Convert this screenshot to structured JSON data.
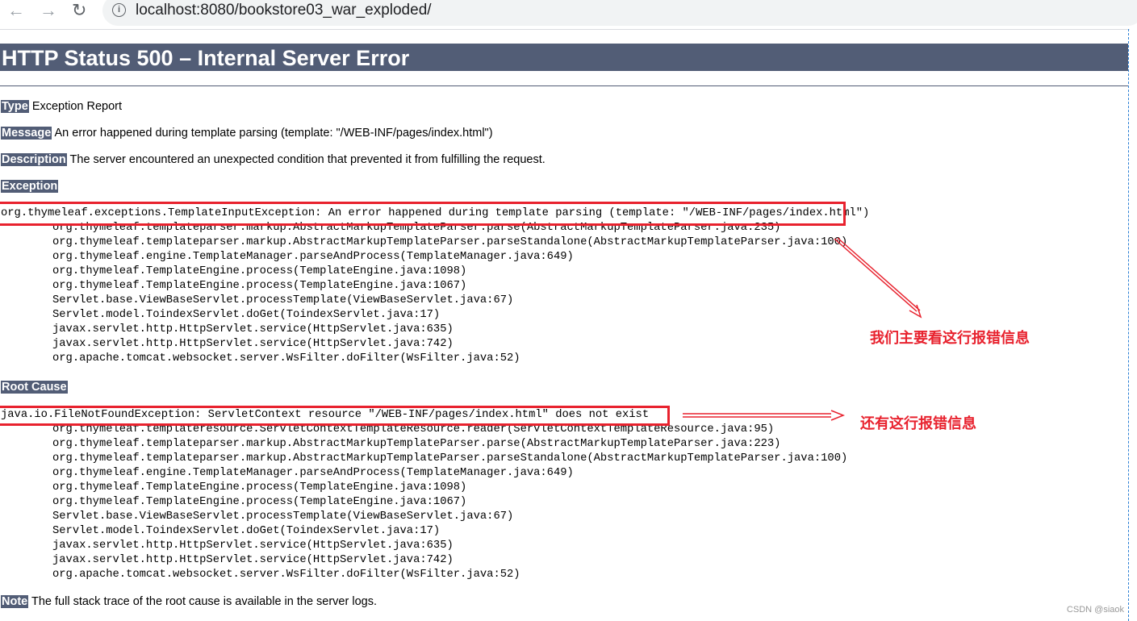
{
  "browser": {
    "url": "localhost:8080/bookstore03_war_exploded/"
  },
  "page": {
    "title": "HTTP Status 500 – Internal Server Error",
    "type": {
      "label": "Type",
      "value": "Exception Report"
    },
    "message": {
      "label": "Message",
      "value": "An error happened during template parsing (template: \"/WEB-INF/pages/index.html\")"
    },
    "description": {
      "label": "Description",
      "value": "The server encountered an unexpected condition that prevented it from fulfilling the request."
    },
    "exception": {
      "label": "Exception",
      "head": "org.thymeleaf.exceptions.TemplateInputException: An error happened during template parsing (template: \"/WEB-INF/pages/index.html\")",
      "lines": [
        "org.thymeleaf.templateparser.markup.AbstractMarkupTemplateParser.parse(AbstractMarkupTemplateParser.java:235)",
        "org.thymeleaf.templateparser.markup.AbstractMarkupTemplateParser.parseStandalone(AbstractMarkupTemplateParser.java:100)",
        "org.thymeleaf.engine.TemplateManager.parseAndProcess(TemplateManager.java:649)",
        "org.thymeleaf.TemplateEngine.process(TemplateEngine.java:1098)",
        "org.thymeleaf.TemplateEngine.process(TemplateEngine.java:1067)",
        "Servlet.base.ViewBaseServlet.processTemplate(ViewBaseServlet.java:67)",
        "Servlet.model.ToindexServlet.doGet(ToindexServlet.java:17)",
        "javax.servlet.http.HttpServlet.service(HttpServlet.java:635)",
        "javax.servlet.http.HttpServlet.service(HttpServlet.java:742)",
        "org.apache.tomcat.websocket.server.WsFilter.doFilter(WsFilter.java:52)"
      ]
    },
    "root_cause": {
      "label": "Root Cause",
      "head": "java.io.FileNotFoundException: ServletContext resource \"/WEB-INF/pages/index.html\" does not exist",
      "lines": [
        "org.thymeleaf.templateresource.ServletContextTemplateResource.reader(ServletContextTemplateResource.java:95)",
        "org.thymeleaf.templateparser.markup.AbstractMarkupTemplateParser.parse(AbstractMarkupTemplateParser.java:223)",
        "org.thymeleaf.templateparser.markup.AbstractMarkupTemplateParser.parseStandalone(AbstractMarkupTemplateParser.java:100)",
        "org.thymeleaf.engine.TemplateManager.parseAndProcess(TemplateManager.java:649)",
        "org.thymeleaf.TemplateEngine.process(TemplateEngine.java:1098)",
        "org.thymeleaf.TemplateEngine.process(TemplateEngine.java:1067)",
        "Servlet.base.ViewBaseServlet.processTemplate(ViewBaseServlet.java:67)",
        "Servlet.model.ToindexServlet.doGet(ToindexServlet.java:17)",
        "javax.servlet.http.HttpServlet.service(HttpServlet.java:635)",
        "javax.servlet.http.HttpServlet.service(HttpServlet.java:742)",
        "org.apache.tomcat.websocket.server.WsFilter.doFilter(WsFilter.java:52)"
      ]
    },
    "note": {
      "label": "Note",
      "value": "The full stack trace of the root cause is available in the server logs."
    }
  },
  "annotations": {
    "note1": "我们主要看这行报错信息",
    "note2": "还有这行报错信息",
    "color": "#e8222e"
  },
  "watermark": "CSDN @siaok"
}
